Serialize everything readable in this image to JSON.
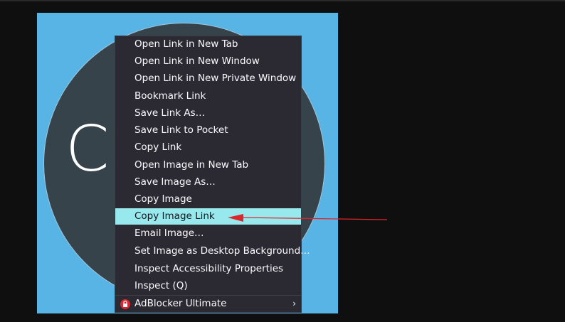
{
  "image": {
    "letter": "C",
    "background_color": "#58b4e4",
    "circle_color": "#37434b"
  },
  "context_menu": {
    "items": [
      {
        "label": "Open Link in New Tab"
      },
      {
        "label": "Open Link in New Window"
      },
      {
        "label": "Open Link in New Private Window"
      },
      {
        "label": "Bookmark Link"
      },
      {
        "label": "Save Link As…"
      },
      {
        "label": "Save Link to Pocket"
      },
      {
        "label": "Copy Link"
      },
      {
        "label": "Open Image in New Tab"
      },
      {
        "label": "Save Image As…"
      },
      {
        "label": "Copy Image"
      },
      {
        "label": "Copy Image Link"
      },
      {
        "label": "Email Image…"
      },
      {
        "label": "Set Image as Desktop Background…"
      },
      {
        "label": "Inspect Accessibility Properties"
      },
      {
        "label": "Inspect (Q)"
      },
      {
        "label": "AdBlocker Ultimate",
        "icon": "adblocker-icon",
        "submenu": true
      }
    ],
    "highlighted_index": 10,
    "highlight_color": "#97e9ee"
  },
  "annotation": {
    "arrow_color": "#e0242b",
    "icon": "red-arrow-icon"
  }
}
